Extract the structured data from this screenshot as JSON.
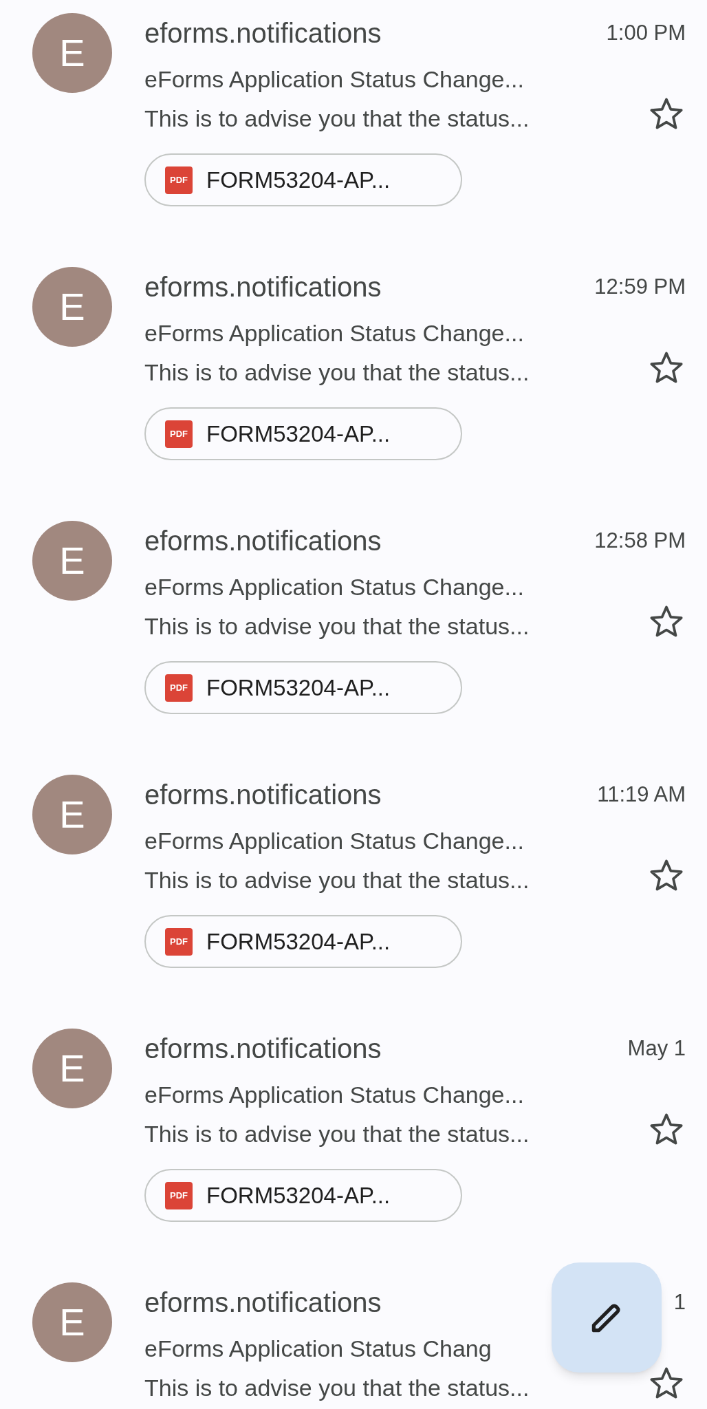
{
  "emails": [
    {
      "avatar": "E",
      "sender": "eforms.notifications",
      "time": "1:00 PM",
      "subject": "eForms Application Status Change...",
      "snippet": "This is to advise you that the status...",
      "starred": false,
      "attachment": {
        "badge": "PDF",
        "name": "FORM53204-AP..."
      }
    },
    {
      "avatar": "E",
      "sender": "eforms.notifications",
      "time": "12:59 PM",
      "subject": "eForms Application Status Change...",
      "snippet": "This is to advise you that the status...",
      "starred": false,
      "attachment": {
        "badge": "PDF",
        "name": "FORM53204-AP..."
      }
    },
    {
      "avatar": "E",
      "sender": "eforms.notifications",
      "time": "12:58 PM",
      "subject": "eForms Application Status Change...",
      "snippet": "This is to advise you that the status...",
      "starred": false,
      "attachment": {
        "badge": "PDF",
        "name": "FORM53204-AP..."
      }
    },
    {
      "avatar": "E",
      "sender": "eforms.notifications",
      "time": "11:19 AM",
      "subject": "eForms Application Status Change...",
      "snippet": "This is to advise you that the status...",
      "starred": false,
      "attachment": {
        "badge": "PDF",
        "name": "FORM53204-AP..."
      }
    },
    {
      "avatar": "E",
      "sender": "eforms.notifications",
      "time": "May 1",
      "subject": "eForms Application Status Change...",
      "snippet": "This is to advise you that the status...",
      "starred": false,
      "attachment": {
        "badge": "PDF",
        "name": "FORM53204-AP..."
      }
    },
    {
      "avatar": "E",
      "sender": "eforms.notifications",
      "time": "1",
      "subject": "eForms Application Status Chang",
      "snippet": "This is to advise you that the status...",
      "starred": false
    }
  ]
}
